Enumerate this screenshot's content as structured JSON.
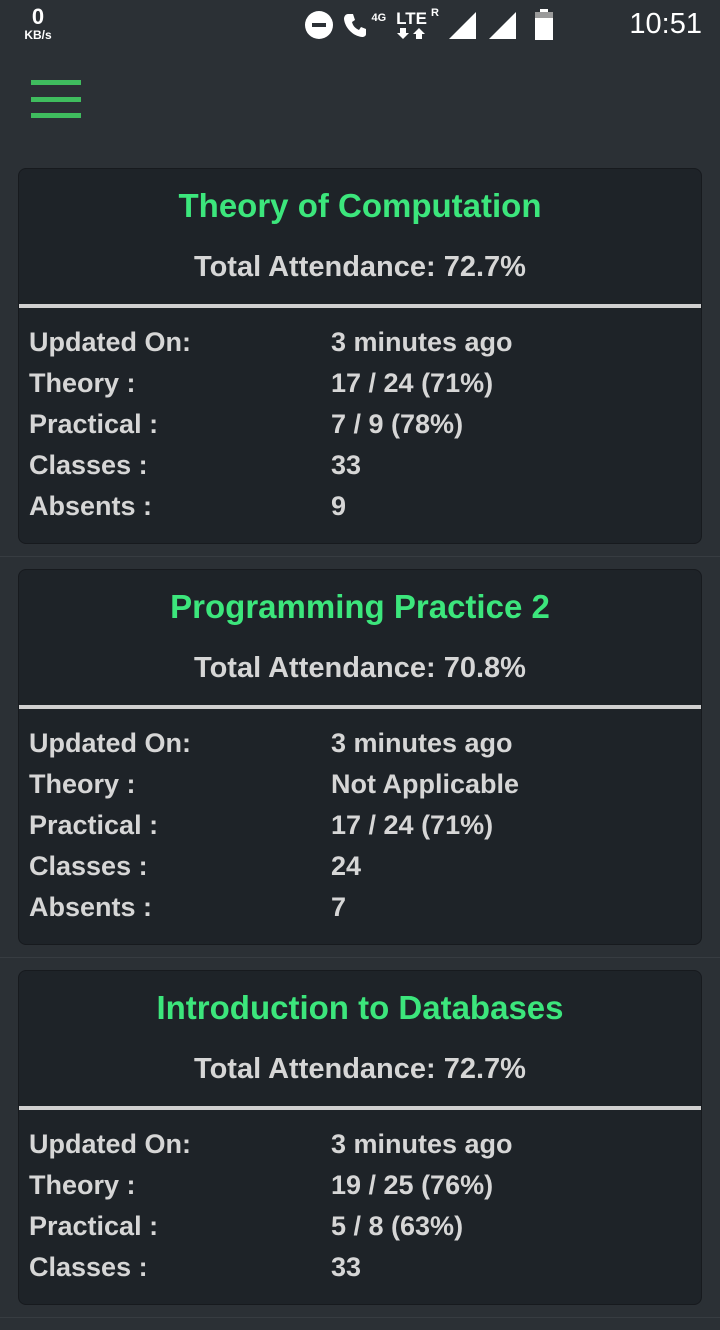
{
  "status_bar": {
    "net_speed_value": "0",
    "net_speed_unit": "KB/s",
    "network_4g": "4G",
    "network_lte": "LTE",
    "roaming": "R",
    "time": "10:51"
  },
  "header": {
    "menu_icon": "hamburger-menu-icon"
  },
  "cards": [
    {
      "title": "Theory of Computation",
      "total_attendance": "Total Attendance: 72.7%",
      "rows": [
        {
          "label": "Updated On:",
          "value": "3 minutes ago"
        },
        {
          "label": "Theory :",
          "value": "17 / 24 (71%)"
        },
        {
          "label": "Practical :",
          "value": "7 / 9 (78%)"
        },
        {
          "label": "Classes :",
          "value": "33"
        },
        {
          "label": "Absents :",
          "value": "9"
        }
      ]
    },
    {
      "title": "Programming Practice 2",
      "total_attendance": "Total Attendance: 70.8%",
      "rows": [
        {
          "label": "Updated On:",
          "value": "3 minutes ago"
        },
        {
          "label": "Theory :",
          "value": "Not Applicable"
        },
        {
          "label": "Practical :",
          "value": "17 / 24 (71%)"
        },
        {
          "label": "Classes :",
          "value": "24"
        },
        {
          "label": "Absents :",
          "value": "7"
        }
      ]
    },
    {
      "title": "Introduction to Databases",
      "total_attendance": "Total Attendance: 72.7%",
      "rows": [
        {
          "label": "Updated On:",
          "value": "3 minutes ago"
        },
        {
          "label": "Theory :",
          "value": "19 / 25 (76%)"
        },
        {
          "label": "Practical :",
          "value": "5 / 8 (63%)"
        },
        {
          "label": "Classes :",
          "value": "33"
        }
      ]
    }
  ],
  "colors": {
    "background": "#2b3035",
    "card": "#1e2328",
    "accent_green": "#3ce67c",
    "menu_green": "#3fbd5e",
    "text": "#d6d6d6"
  }
}
